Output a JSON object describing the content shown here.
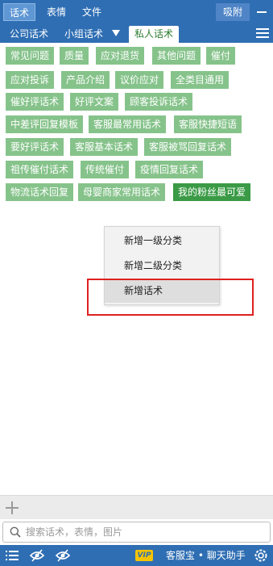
{
  "top_tabs": [
    "话术",
    "表情",
    "文件"
  ],
  "top_right": {
    "pin_label": "吸附"
  },
  "sub_tabs": {
    "company": "公司话术",
    "group": "小组话术",
    "private": "私人话术"
  },
  "chips": [
    "常见问题",
    "质量",
    "应对退货",
    "其他问题",
    "催付",
    "应对投诉",
    "产品介绍",
    "议价应对",
    "全类目通用",
    "催好评话术",
    "好评文案",
    "顾客投诉话术",
    "中差评回复模板",
    "客服最常用话术",
    "客服快捷短语",
    "要好评话术",
    "客服基本话术",
    "客服被骂回复话术",
    "祖传催付话术",
    "传统催付",
    "疫情回复话术",
    "物流话术回复",
    "母婴商家常用话术",
    "我的粉丝最可爱"
  ],
  "context_menu": {
    "items": [
      "新增一级分类",
      "新增二级分类",
      "新增话术"
    ]
  },
  "search": {
    "placeholder": "搜索话术，表情，图片"
  },
  "bottom": {
    "vip_label": "VIP",
    "brand": "客服宝 • 聊天助手"
  },
  "colors": {
    "primary": "#2f6eb3",
    "chip": "#86c38b",
    "chip_active": "#3a9a45",
    "highlight": "#e02020"
  }
}
